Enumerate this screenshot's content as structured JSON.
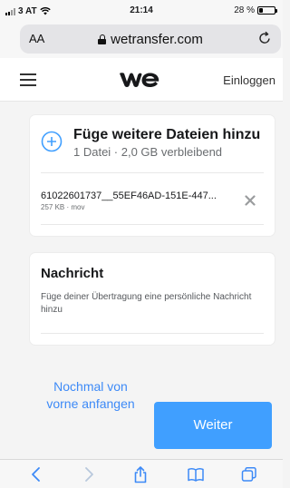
{
  "status_bar": {
    "carrier": "3 AT",
    "time": "21:14",
    "battery": "28 %",
    "battery_level": 0.28
  },
  "browser": {
    "text_size_label": "AA",
    "url": "wetransfer.com"
  },
  "header": {
    "login_label": "Einloggen"
  },
  "files_card": {
    "title": "Füge weitere Dateien hinzu",
    "subtitle": "1 Datei · 2,0 GB verbleibend",
    "files": [
      {
        "name": "61022601737__55EF46AD-151E-447...",
        "meta": "257 KB · mov"
      }
    ]
  },
  "message_card": {
    "title": "Nachricht",
    "placeholder": "Füge deiner Übertragung eine persönliche Nachricht hinzu"
  },
  "actions": {
    "restart_label": "Nochmal von vorne anfangen",
    "next_label": "Weiter"
  },
  "colors": {
    "accent": "#409fff",
    "link": "#3d8af7"
  }
}
